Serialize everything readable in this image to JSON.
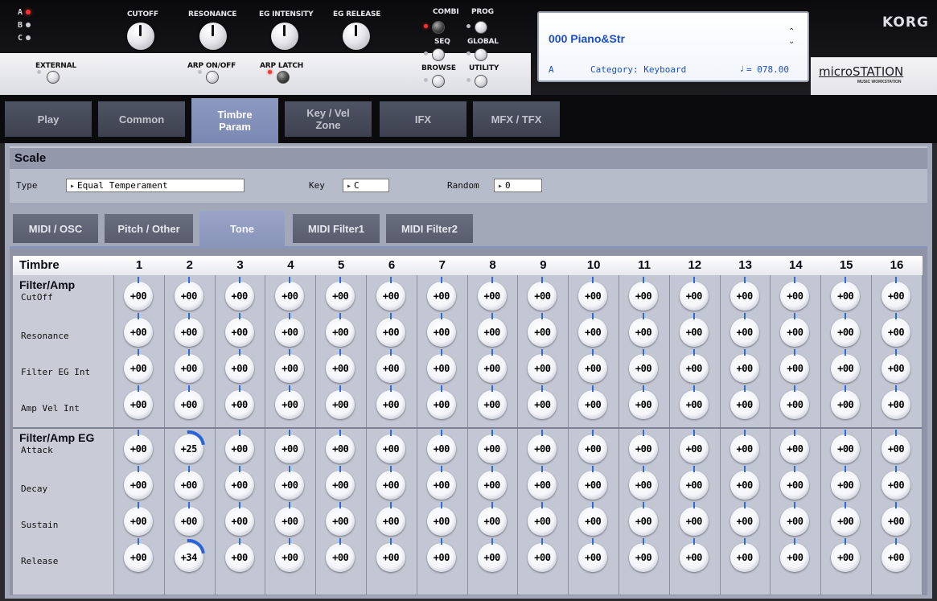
{
  "hardware": {
    "mode_leds": [
      {
        "letter": "A",
        "on": true
      },
      {
        "letter": "B",
        "on": false
      },
      {
        "letter": "C",
        "on": false
      }
    ],
    "knob_labels": [
      "CUTOFF",
      "RESONANCE",
      "EG INTENSITY",
      "EG RELEASE"
    ],
    "external_label": "EXTERNAL",
    "arp_onoff_label": "ARP ON/OFF",
    "arp_latch_label": "ARP LATCH",
    "mode_buttons": {
      "combi": "COMBI",
      "prog": "PROG",
      "seq": "SEQ",
      "global": "GLOBAL",
      "browse": "BROWSE",
      "utility": "UTILITY"
    },
    "brand": "KORG",
    "model": "microSTATION",
    "model_sub": "MUSIC WORKSTATION"
  },
  "lcd": {
    "program": "000 Piano&Str",
    "bank": "A",
    "category": "Category: Keyboard",
    "tempo": "= 078.00"
  },
  "page_tabs": [
    "Play",
    "Common",
    "Timbre Param",
    "Key / Vel Zone",
    "IFX",
    "MFX / TFX"
  ],
  "active_page_tab": "Timbre Param",
  "scale": {
    "title": "Scale",
    "type_label": "Type",
    "type_value": "Equal Temperament",
    "key_label": "Key",
    "key_value": "C",
    "random_label": "Random",
    "random_value": "0"
  },
  "sub_tabs": [
    "MIDI / OSC",
    "Pitch / Other",
    "Tone",
    "MIDI Filter1",
    "MIDI Filter2"
  ],
  "active_sub_tab": "Tone",
  "grid": {
    "header_label": "Timbre",
    "timbres": [
      "1",
      "2",
      "3",
      "4",
      "5",
      "6",
      "7",
      "8",
      "9",
      "10",
      "11",
      "12",
      "13",
      "14",
      "15",
      "16"
    ],
    "sections": [
      {
        "title": "Filter/Amp",
        "params": [
          {
            "name": "CutOff",
            "values": [
              "+00",
              "+00",
              "+00",
              "+00",
              "+00",
              "+00",
              "+00",
              "+00",
              "+00",
              "+00",
              "+00",
              "+00",
              "+00",
              "+00",
              "+00",
              "+00"
            ]
          },
          {
            "name": "Resonance",
            "values": [
              "+00",
              "+00",
              "+00",
              "+00",
              "+00",
              "+00",
              "+00",
              "+00",
              "+00",
              "+00",
              "+00",
              "+00",
              "+00",
              "+00",
              "+00",
              "+00"
            ]
          },
          {
            "name": "Filter EG Int",
            "values": [
              "+00",
              "+00",
              "+00",
              "+00",
              "+00",
              "+00",
              "+00",
              "+00",
              "+00",
              "+00",
              "+00",
              "+00",
              "+00",
              "+00",
              "+00",
              "+00"
            ]
          },
          {
            "name": "Amp Vel Int",
            "values": [
              "+00",
              "+00",
              "+00",
              "+00",
              "+00",
              "+00",
              "+00",
              "+00",
              "+00",
              "+00",
              "+00",
              "+00",
              "+00",
              "+00",
              "+00",
              "+00"
            ]
          }
        ]
      },
      {
        "title": "Filter/Amp EG",
        "params": [
          {
            "name": "Attack",
            "values": [
              "+00",
              "+25",
              "+00",
              "+00",
              "+00",
              "+00",
              "+00",
              "+00",
              "+00",
              "+00",
              "+00",
              "+00",
              "+00",
              "+00",
              "+00",
              "+00"
            ]
          },
          {
            "name": "Decay",
            "values": [
              "+00",
              "+00",
              "+00",
              "+00",
              "+00",
              "+00",
              "+00",
              "+00",
              "+00",
              "+00",
              "+00",
              "+00",
              "+00",
              "+00",
              "+00",
              "+00"
            ]
          },
          {
            "name": "Sustain",
            "values": [
              "+00",
              "+00",
              "+00",
              "+00",
              "+00",
              "+00",
              "+00",
              "+00",
              "+00",
              "+00",
              "+00",
              "+00",
              "+00",
              "+00",
              "+00",
              "+00"
            ]
          },
          {
            "name": "Release",
            "values": [
              "+00",
              "+34",
              "+00",
              "+00",
              "+00",
              "+00",
              "+00",
              "+00",
              "+00",
              "+00",
              "+00",
              "+00",
              "+00",
              "+00",
              "+00",
              "+00"
            ]
          }
        ]
      }
    ]
  },
  "colors": {
    "accent": "#2b62d8",
    "lcd_text": "#1a4fc9",
    "tab_active": "#8894b8"
  }
}
